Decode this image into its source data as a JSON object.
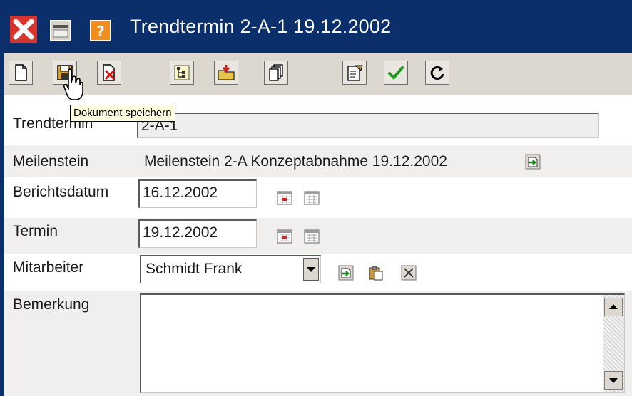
{
  "window": {
    "title": "Trendtermin 2-A-1 19.12.2002",
    "title_icons": [
      "close-icon",
      "minimize-icon",
      "help-icon"
    ]
  },
  "toolbar": {
    "buttons": [
      {
        "name": "new-document",
        "icon": "new-document-icon"
      },
      {
        "name": "save-document",
        "icon": "save-icon"
      },
      {
        "name": "delete-document",
        "icon": "delete-icon"
      },
      {
        "name": "structure",
        "icon": "tree-icon"
      },
      {
        "name": "open-folder",
        "icon": "folder-icon"
      },
      {
        "name": "copy",
        "icon": "copy-icon"
      },
      {
        "name": "properties",
        "icon": "properties-icon"
      },
      {
        "name": "confirm",
        "icon": "checkmark-icon"
      },
      {
        "name": "refresh",
        "icon": "refresh-icon"
      }
    ],
    "tooltip": "Dokument speichern"
  },
  "form": {
    "trendtermin": {
      "label": "Trendtermin",
      "value": "2-A-1"
    },
    "meilenstein": {
      "label": "Meilenstein",
      "value": "Meilenstein 2-A Konzeptabnahme 19.12.2002"
    },
    "berichtsdatum": {
      "label": "Berichtsdatum",
      "value": "16.12.2002"
    },
    "termin": {
      "label": "Termin",
      "value": "19.12.2002"
    },
    "mitarbeiter": {
      "label": "Mitarbeiter",
      "value": "Schmidt Frank"
    },
    "bemerkung": {
      "label": "Bemerkung",
      "value": ""
    }
  },
  "colors": {
    "titlebar": "#0a2f6b",
    "toolbar": "#dcd8d0",
    "row_shade": "#f1eeee",
    "tooltip": "#ffffe1"
  }
}
